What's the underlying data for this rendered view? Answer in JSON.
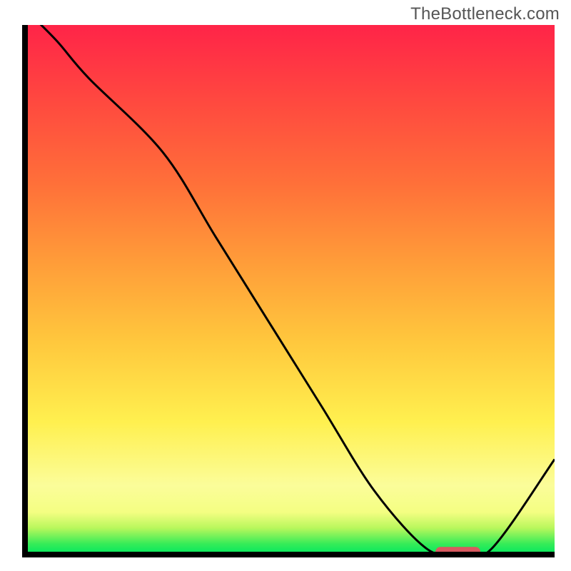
{
  "watermark": "TheBottleneck.com",
  "chart_data": {
    "type": "line",
    "title": "",
    "xlabel": "",
    "ylabel": "",
    "xlim": [
      0,
      100
    ],
    "ylim": [
      0,
      100
    ],
    "x": [
      0,
      6,
      12,
      26,
      36,
      46,
      56,
      66,
      76,
      82,
      88,
      100
    ],
    "y": [
      103,
      97,
      90,
      76,
      60,
      44,
      28,
      12,
      1,
      0.5,
      1,
      18
    ],
    "series_name": "bottleneck_curve",
    "background_gradient": {
      "description": "vertical gradient from green (bottom) through yellow/orange to red (top) representing bottleneck severity",
      "stops": [
        {
          "pos": 0.0,
          "color": "#00e85f"
        },
        {
          "pos": 0.02,
          "color": "#35ec58"
        },
        {
          "pos": 0.05,
          "color": "#b8f75c"
        },
        {
          "pos": 0.08,
          "color": "#f4fe82"
        },
        {
          "pos": 0.13,
          "color": "#fbfd9a"
        },
        {
          "pos": 0.25,
          "color": "#fff04f"
        },
        {
          "pos": 0.4,
          "color": "#ffc83d"
        },
        {
          "pos": 0.55,
          "color": "#ff9d39"
        },
        {
          "pos": 0.7,
          "color": "#ff7039"
        },
        {
          "pos": 0.85,
          "color": "#ff4a3f"
        },
        {
          "pos": 1.0,
          "color": "#ff2448"
        }
      ]
    },
    "marker_bar": {
      "x_start": 77.5,
      "x_end": 86,
      "y": 0.5,
      "color": "#d85a60"
    }
  },
  "plot": {
    "margin_left": 35,
    "margin_top": 35,
    "inner_width": 742,
    "inner_height": 742,
    "axis_stroke_width": 8,
    "curve_stroke_width": 3,
    "marker_height": 14,
    "marker_rx": 7
  }
}
